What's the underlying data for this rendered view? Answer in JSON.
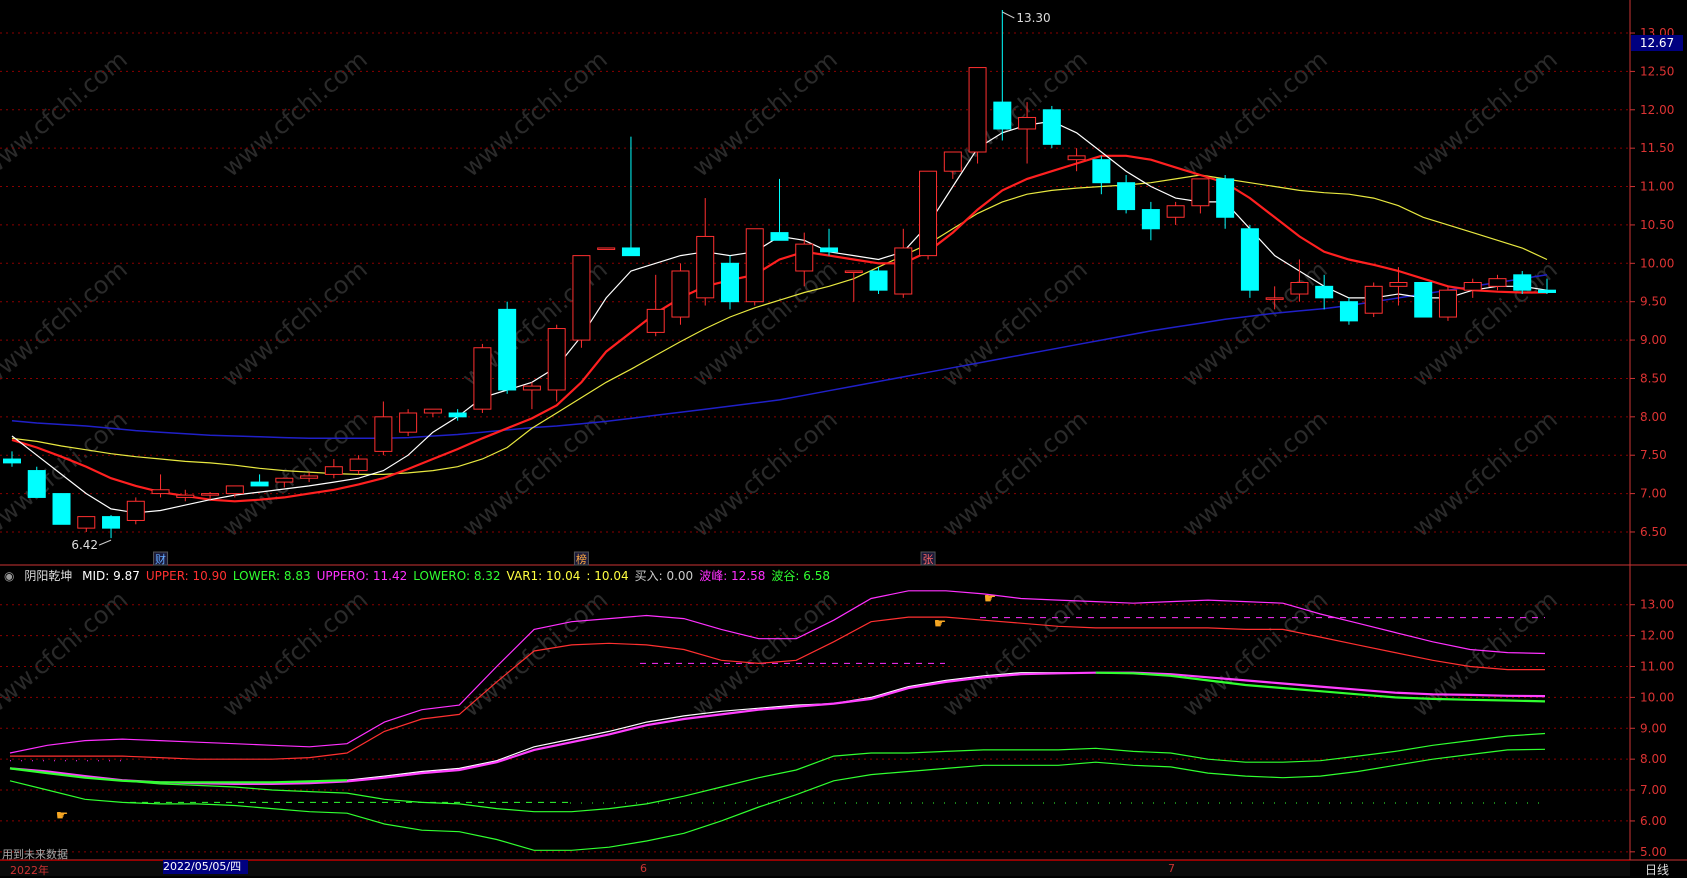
{
  "main": {
    "high_label": "13.30",
    "low_label": "6.42",
    "current_price": "12.67",
    "y_ticks": [
      "13.00",
      "12.50",
      "12.00",
      "11.50",
      "11.00",
      "10.50",
      "10.00",
      "9.50",
      "9.00",
      "8.50",
      "8.00",
      "7.50",
      "7.00",
      "6.50"
    ],
    "markers": [
      {
        "label": "财"
      },
      {
        "label": "榜"
      },
      {
        "label": "张"
      }
    ],
    "colors": {
      "up": "#ff3030",
      "down": "#00ffff",
      "ma5": "#ffffff",
      "ma10": "#ff2020",
      "ma20": "#e8e840",
      "ma60": "#2020c8",
      "grid": "#8b0000"
    }
  },
  "indicator": {
    "name": "阴阳乾坤",
    "values": [
      {
        "label": "MID: 9.87",
        "color": "#ffffff"
      },
      {
        "label": "UPPER: 10.90",
        "color": "#ff3030"
      },
      {
        "label": "LOWER: 8.83",
        "color": "#30ff30"
      },
      {
        "label": "UPPERO: 11.42",
        "color": "#ff30ff"
      },
      {
        "label": "LOWERO: 8.32",
        "color": "#30ff30"
      },
      {
        "label": "VAR1: 10.04",
        "color": "#ffff40"
      },
      {
        "label": ": 10.04",
        "color": "#ffff40"
      },
      {
        "label": "买入: 0.00",
        "color": "#cccccc"
      },
      {
        "label": "波峰: 12.58",
        "color": "#ff30ff"
      },
      {
        "label": "波谷: 6.58",
        "color": "#30ff30"
      }
    ],
    "y_ticks": [
      "13.00",
      "12.00",
      "11.00",
      "10.00",
      "9.00",
      "8.00",
      "7.00",
      "6.00",
      "5.00"
    ],
    "note": "用到未来数据"
  },
  "bottom": {
    "year_label": "2022年",
    "date_box": "2022/05/05/四",
    "month_6": "6",
    "month_7": "7",
    "period": "日线"
  },
  "watermark": "www.cfchi.com",
  "chart_data": [
    {
      "type": "candlestick",
      "title": "",
      "ylim": [
        6.2,
        13.3
      ],
      "candles": [
        {
          "o": 7.45,
          "h": 7.55,
          "l": 7.35,
          "c": 7.4
        },
        {
          "o": 7.3,
          "h": 7.35,
          "l": 6.95,
          "c": 6.95
        },
        {
          "o": 7.0,
          "h": 7.0,
          "l": 6.6,
          "c": 6.6
        },
        {
          "o": 6.55,
          "h": 6.7,
          "l": 6.5,
          "c": 6.7
        },
        {
          "o": 6.7,
          "h": 6.72,
          "l": 6.42,
          "c": 6.55
        },
        {
          "o": 6.65,
          "h": 6.95,
          "l": 6.6,
          "c": 6.9
        },
        {
          "o": 7.0,
          "h": 7.25,
          "l": 6.95,
          "c": 7.05
        },
        {
          "o": 6.95,
          "h": 7.05,
          "l": 6.9,
          "c": 6.98
        },
        {
          "o": 6.98,
          "h": 7.02,
          "l": 6.92,
          "c": 7.0
        },
        {
          "o": 7.0,
          "h": 7.1,
          "l": 6.95,
          "c": 7.1
        },
        {
          "o": 7.15,
          "h": 7.25,
          "l": 7.1,
          "c": 7.1
        },
        {
          "o": 7.15,
          "h": 7.2,
          "l": 7.08,
          "c": 7.2
        },
        {
          "o": 7.2,
          "h": 7.28,
          "l": 7.15,
          "c": 7.23
        },
        {
          "o": 7.25,
          "h": 7.45,
          "l": 7.2,
          "c": 7.35
        },
        {
          "o": 7.3,
          "h": 7.5,
          "l": 7.25,
          "c": 7.45
        },
        {
          "o": 7.55,
          "h": 8.2,
          "l": 7.5,
          "c": 8.0
        },
        {
          "o": 7.8,
          "h": 8.1,
          "l": 7.75,
          "c": 8.05
        },
        {
          "o": 8.05,
          "h": 8.1,
          "l": 8.0,
          "c": 8.1
        },
        {
          "o": 8.05,
          "h": 8.1,
          "l": 7.95,
          "c": 8.0
        },
        {
          "o": 8.1,
          "h": 8.95,
          "l": 8.05,
          "c": 8.9
        },
        {
          "o": 9.4,
          "h": 9.5,
          "l": 8.3,
          "c": 8.35
        },
        {
          "o": 8.35,
          "h": 8.45,
          "l": 8.1,
          "c": 8.4
        },
        {
          "o": 8.35,
          "h": 9.2,
          "l": 8.2,
          "c": 9.15
        },
        {
          "o": 9.0,
          "h": 10.1,
          "l": 8.9,
          "c": 10.1
        },
        {
          "o": 10.2,
          "h": 10.2,
          "l": 10.2,
          "c": 10.2
        },
        {
          "o": 10.2,
          "h": 11.65,
          "l": 10.1,
          "c": 10.1
        },
        {
          "o": 9.1,
          "h": 9.85,
          "l": 9.05,
          "c": 9.4
        },
        {
          "o": 9.3,
          "h": 10.0,
          "l": 9.2,
          "c": 9.9
        },
        {
          "o": 9.55,
          "h": 10.85,
          "l": 9.45,
          "c": 10.35
        },
        {
          "o": 10.0,
          "h": 10.1,
          "l": 9.4,
          "c": 9.5
        },
        {
          "o": 9.5,
          "h": 10.45,
          "l": 9.45,
          "c": 10.45
        },
        {
          "o": 10.4,
          "h": 11.1,
          "l": 10.3,
          "c": 10.3
        },
        {
          "o": 9.9,
          "h": 10.4,
          "l": 9.7,
          "c": 10.25
        },
        {
          "o": 10.2,
          "h": 10.45,
          "l": 10.1,
          "c": 10.15
        },
        {
          "o": 9.9,
          "h": 9.9,
          "l": 9.5,
          "c": 9.9
        },
        {
          "o": 9.9,
          "h": 9.95,
          "l": 9.6,
          "c": 9.65
        },
        {
          "o": 9.6,
          "h": 10.45,
          "l": 9.55,
          "c": 10.2
        },
        {
          "o": 10.1,
          "h": 11.2,
          "l": 10.05,
          "c": 11.2
        },
        {
          "o": 11.2,
          "h": 11.45,
          "l": 11.1,
          "c": 11.45
        },
        {
          "o": 11.45,
          "h": 12.55,
          "l": 11.3,
          "c": 12.55
        },
        {
          "o": 12.1,
          "h": 13.3,
          "l": 11.6,
          "c": 11.75
        },
        {
          "o": 11.75,
          "h": 12.1,
          "l": 11.3,
          "c": 11.9
        },
        {
          "o": 12.0,
          "h": 12.05,
          "l": 11.5,
          "c": 11.55
        },
        {
          "o": 11.35,
          "h": 11.5,
          "l": 11.2,
          "c": 11.4
        },
        {
          "o": 11.35,
          "h": 11.4,
          "l": 10.9,
          "c": 11.05
        },
        {
          "o": 11.05,
          "h": 11.15,
          "l": 10.65,
          "c": 10.7
        },
        {
          "o": 10.7,
          "h": 10.8,
          "l": 10.3,
          "c": 10.45
        },
        {
          "o": 10.6,
          "h": 10.8,
          "l": 10.5,
          "c": 10.75
        },
        {
          "o": 10.75,
          "h": 11.1,
          "l": 10.65,
          "c": 11.1
        },
        {
          "o": 11.1,
          "h": 11.15,
          "l": 10.45,
          "c": 10.6
        },
        {
          "o": 10.45,
          "h": 10.5,
          "l": 9.55,
          "c": 9.65
        },
        {
          "o": 9.55,
          "h": 9.7,
          "l": 9.4,
          "c": 9.55
        },
        {
          "o": 9.6,
          "h": 10.05,
          "l": 9.5,
          "c": 9.75
        },
        {
          "o": 9.7,
          "h": 9.85,
          "l": 9.4,
          "c": 9.55
        },
        {
          "o": 9.5,
          "h": 9.55,
          "l": 9.2,
          "c": 9.25
        },
        {
          "o": 9.35,
          "h": 9.75,
          "l": 9.3,
          "c": 9.7
        },
        {
          "o": 9.7,
          "h": 9.95,
          "l": 9.45,
          "c": 9.75
        },
        {
          "o": 9.75,
          "h": 9.75,
          "l": 9.3,
          "c": 9.3
        },
        {
          "o": 9.3,
          "h": 9.7,
          "l": 9.25,
          "c": 9.65
        },
        {
          "o": 9.65,
          "h": 9.8,
          "l": 9.55,
          "c": 9.75
        },
        {
          "o": 9.7,
          "h": 9.85,
          "l": 9.65,
          "c": 9.8
        },
        {
          "o": 9.85,
          "h": 9.9,
          "l": 9.6,
          "c": 9.65
        },
        {
          "o": 9.65,
          "h": 9.8,
          "l": 9.6,
          "c": 9.62
        }
      ],
      "ma5": [
        7.75,
        7.5,
        7.25,
        7.0,
        6.8,
        6.75,
        6.78,
        6.85,
        6.92,
        6.98,
        7.02,
        7.06,
        7.1,
        7.15,
        7.2,
        7.3,
        7.5,
        7.8,
        8.0,
        8.25,
        8.35,
        8.45,
        8.65,
        9.05,
        9.55,
        9.9,
        10.0,
        10.1,
        10.15,
        10.1,
        10.15,
        10.35,
        10.3,
        10.15,
        10.1,
        10.05,
        10.15,
        10.5,
        11.0,
        11.5,
        11.7,
        11.8,
        11.85,
        11.7,
        11.45,
        11.2,
        11.0,
        10.85,
        10.8,
        10.8,
        10.45,
        10.1,
        9.9,
        9.7,
        9.55,
        9.55,
        9.6,
        9.55,
        9.55,
        9.65,
        9.7,
        9.7,
        9.65
      ],
      "ma10": [
        7.7,
        7.6,
        7.48,
        7.35,
        7.2,
        7.1,
        7.02,
        6.97,
        6.92,
        6.9,
        6.92,
        6.95,
        7.0,
        7.05,
        7.12,
        7.2,
        7.32,
        7.45,
        7.58,
        7.72,
        7.85,
        7.98,
        8.15,
        8.45,
        8.85,
        9.1,
        9.35,
        9.55,
        9.7,
        9.78,
        9.85,
        10.05,
        10.15,
        10.1,
        10.05,
        10.0,
        10.0,
        10.15,
        10.4,
        10.7,
        10.95,
        11.1,
        11.2,
        11.3,
        11.4,
        11.4,
        11.35,
        11.25,
        11.15,
        11.05,
        10.85,
        10.6,
        10.35,
        10.15,
        10.05,
        9.98,
        9.9,
        9.8,
        9.7,
        9.65,
        9.63,
        9.62,
        9.62
      ],
      "ma20": [
        7.72,
        7.68,
        7.62,
        7.57,
        7.52,
        7.48,
        7.45,
        7.42,
        7.4,
        7.37,
        7.33,
        7.3,
        7.28,
        7.26,
        7.25,
        7.25,
        7.27,
        7.3,
        7.35,
        7.45,
        7.6,
        7.85,
        8.05,
        8.25,
        8.45,
        8.62,
        8.8,
        8.98,
        9.15,
        9.3,
        9.42,
        9.52,
        9.62,
        9.7,
        9.8,
        9.95,
        10.1,
        10.25,
        10.45,
        10.65,
        10.8,
        10.9,
        10.95,
        10.98,
        11.0,
        11.02,
        11.05,
        11.1,
        11.15,
        11.1,
        11.05,
        11.0,
        10.95,
        10.92,
        10.9,
        10.85,
        10.75,
        10.6,
        10.5,
        10.4,
        10.3,
        10.2,
        10.05
      ],
      "ma60": [
        7.95,
        7.92,
        7.9,
        7.88,
        7.85,
        7.82,
        7.8,
        7.78,
        7.76,
        7.75,
        7.74,
        7.73,
        7.72,
        7.72,
        7.72,
        7.72,
        7.73,
        7.75,
        7.77,
        7.8,
        7.83,
        7.86,
        7.88,
        7.91,
        7.94,
        7.98,
        8.02,
        8.06,
        8.1,
        8.14,
        8.18,
        8.22,
        8.28,
        8.34,
        8.4,
        8.46,
        8.52,
        8.58,
        8.64,
        8.7,
        8.76,
        8.82,
        8.88,
        8.94,
        9.0,
        9.06,
        9.12,
        9.17,
        9.22,
        9.27,
        9.31,
        9.35,
        9.38,
        9.41,
        9.45,
        9.5,
        9.55,
        9.6,
        9.65,
        9.7,
        9.75,
        9.8,
        9.85
      ]
    },
    {
      "type": "line",
      "title": "阴阳乾坤",
      "ylim": [
        4.8,
        13.8
      ],
      "series": [
        {
          "name": "MID",
          "color": "#ffffff",
          "values": [
            7.7,
            7.55,
            7.4,
            7.3,
            7.25,
            7.25,
            7.25,
            7.25,
            7.28,
            7.32,
            7.45,
            7.6,
            7.7,
            7.95,
            8.4,
            8.65,
            8.9,
            9.2,
            9.4,
            9.55,
            9.65,
            9.75,
            9.8,
            10.0,
            10.35,
            10.55,
            10.7,
            10.8,
            10.8,
            10.8,
            10.78,
            10.7,
            10.55,
            10.4,
            10.3,
            10.2,
            10.1,
            10.0,
            9.95,
            9.92,
            9.9,
            9.87
          ]
        },
        {
          "name": "UPPER",
          "color": "#ff3030",
          "values": [
            8.1,
            8.1,
            8.1,
            8.1,
            8.05,
            8.0,
            8.0,
            8.0,
            8.05,
            8.2,
            8.9,
            9.3,
            9.45,
            10.5,
            11.5,
            11.7,
            11.75,
            11.7,
            11.55,
            11.2,
            11.1,
            11.2,
            11.8,
            12.45,
            12.6,
            12.6,
            12.5,
            12.4,
            12.3,
            12.25,
            12.25,
            12.25,
            12.25,
            12.2,
            12.2,
            11.95,
            11.7,
            11.45,
            11.2,
            11.0,
            10.9,
            10.9
          ]
        },
        {
          "name": "UPPERO",
          "color": "#ff30ff",
          "values": [
            8.2,
            8.45,
            8.6,
            8.65,
            8.6,
            8.55,
            8.5,
            8.45,
            8.4,
            8.5,
            9.2,
            9.6,
            9.75,
            11.0,
            12.2,
            12.45,
            12.55,
            12.65,
            12.55,
            12.2,
            11.9,
            11.9,
            12.5,
            13.2,
            13.45,
            13.45,
            13.35,
            13.2,
            13.15,
            13.1,
            13.05,
            13.1,
            13.15,
            13.1,
            13.05,
            12.7,
            12.4,
            12.1,
            11.8,
            11.55,
            11.45,
            11.42
          ]
        },
        {
          "name": "LOWER",
          "color": "#30ff30",
          "values": [
            7.7,
            7.6,
            7.45,
            7.3,
            7.2,
            7.15,
            7.1,
            7.0,
            6.95,
            6.9,
            6.7,
            6.6,
            6.55,
            6.4,
            6.3,
            6.3,
            6.4,
            6.55,
            6.8,
            7.1,
            7.4,
            7.65,
            8.1,
            8.2,
            8.2,
            8.25,
            8.3,
            8.3,
            8.3,
            8.35,
            8.25,
            8.2,
            8.0,
            7.9,
            7.9,
            7.95,
            8.1,
            8.25,
            8.45,
            8.6,
            8.75,
            8.83
          ]
        },
        {
          "name": "LOWERO",
          "color": "#30ff30",
          "values": [
            7.3,
            7.0,
            6.7,
            6.6,
            6.55,
            6.55,
            6.5,
            6.4,
            6.3,
            6.25,
            5.9,
            5.7,
            5.65,
            5.4,
            5.05,
            5.05,
            5.15,
            5.35,
            5.6,
            6.0,
            6.45,
            6.85,
            7.3,
            7.5,
            7.6,
            7.7,
            7.8,
            7.8,
            7.8,
            7.9,
            7.8,
            7.75,
            7.55,
            7.45,
            7.4,
            7.45,
            7.6,
            7.8,
            8.0,
            8.15,
            8.3,
            8.32
          ]
        },
        {
          "name": "VAR1",
          "color": "#ff40ff",
          "values": [
            7.7,
            7.6,
            7.45,
            7.32,
            7.25,
            7.22,
            7.2,
            7.2,
            7.22,
            7.28,
            7.4,
            7.55,
            7.65,
            7.9,
            8.3,
            8.55,
            8.8,
            9.1,
            9.3,
            9.45,
            9.6,
            9.7,
            9.8,
            9.95,
            10.3,
            10.5,
            10.65,
            10.75,
            10.78,
            10.8,
            10.8,
            10.75,
            10.65,
            10.55,
            10.45,
            10.35,
            10.25,
            10.15,
            10.1,
            10.08,
            10.05,
            10.04
          ]
        }
      ]
    }
  ]
}
